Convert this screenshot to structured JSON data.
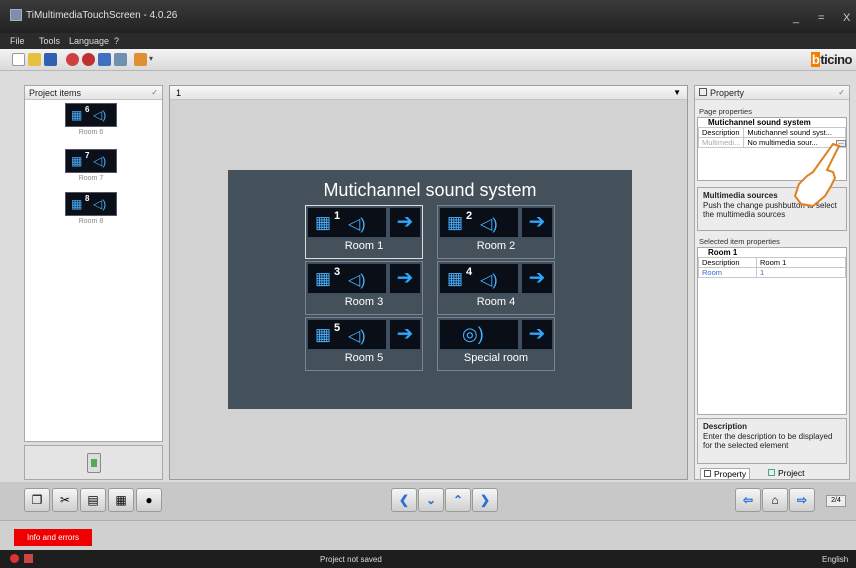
{
  "window": {
    "title": "TiMultimediaTouchScreen - 4.0.26",
    "minimize": "_",
    "maximize": "=",
    "close": "X"
  },
  "menu": [
    "File",
    "Tools",
    "Language",
    "?"
  ],
  "brand": "bticino",
  "project_items": {
    "header": "Project items",
    "items": [
      {
        "num": "6",
        "label": "Room 6"
      },
      {
        "num": "7",
        "label": "Room 7"
      },
      {
        "num": "8",
        "label": "Room 8"
      }
    ]
  },
  "editor": {
    "page_number": "1",
    "page_title": "Mutichannel sound system",
    "rooms": [
      {
        "num": "1",
        "label": "Room 1"
      },
      {
        "num": "2",
        "label": "Room 2"
      },
      {
        "num": "3",
        "label": "Room 3"
      },
      {
        "num": "4",
        "label": "Room 4"
      },
      {
        "num": "5",
        "label": "Room 5"
      },
      {
        "num": "",
        "label": "Special room"
      }
    ]
  },
  "property": {
    "header": "Property",
    "page_properties_label": "Page properties",
    "page_section": "Mutichannel sound system",
    "page_rows": [
      {
        "key": "Description",
        "value": "Mutichannel sound syst..."
      },
      {
        "key": "Multimedi...",
        "value": "No multimedia sour..."
      }
    ],
    "multimedia_help": {
      "title": "Multimedia sources",
      "text": "Push the change pushbutton to select the multimedia sources"
    },
    "selected_label": "Selected item properties",
    "item_section": "Room 1",
    "item_rows": [
      {
        "key": "Description",
        "value": "Room 1"
      },
      {
        "key": "Room",
        "value": "1"
      }
    ],
    "description_help": {
      "title": "Description",
      "text": "Enter the description to be displayed for the selected element"
    },
    "tabs": [
      "Property",
      "Project"
    ]
  },
  "page_counter": "2/4",
  "info_button": "Info and errors",
  "status": {
    "center": "Project not saved",
    "right": "English"
  }
}
